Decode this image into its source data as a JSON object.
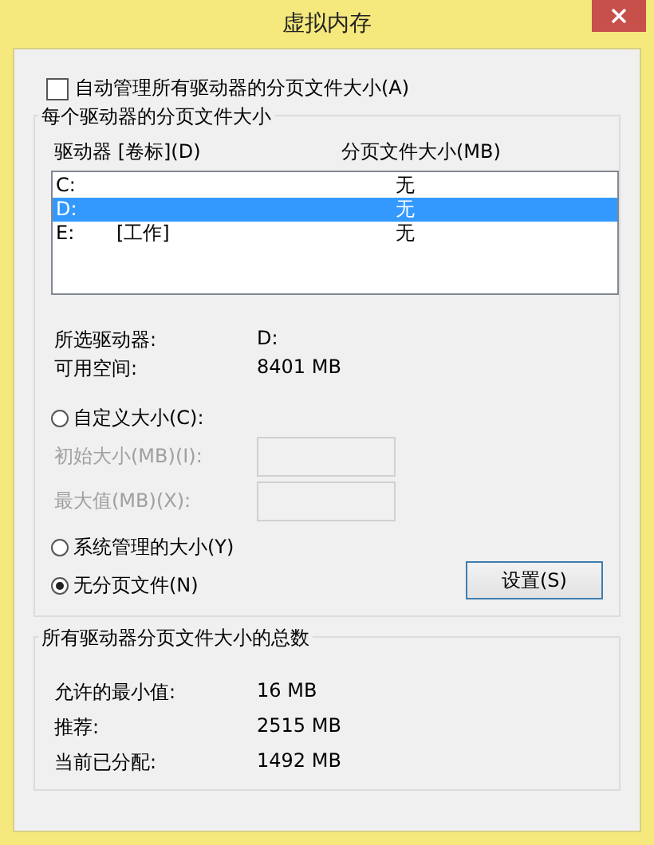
{
  "window": {
    "title": "虚拟内存"
  },
  "auto_manage": {
    "label": "自动管理所有驱动器的分页文件大小(A)",
    "checked": false
  },
  "per_drive": {
    "title": "每个驱动器的分页文件大小",
    "columns": [
      "驱动器 [卷标](D)",
      "分页文件大小(MB)"
    ],
    "drives": [
      {
        "drive": "C:",
        "size": "无",
        "selected": false
      },
      {
        "drive": "D:",
        "size": "无",
        "selected": true
      },
      {
        "drive": "E:",
        "label": "[工作]",
        "size": "无",
        "selected": false
      }
    ],
    "info": [
      {
        "label": "所选驱动器:",
        "value": "D:"
      },
      {
        "label": "可用空间:",
        "value": "8401 MB"
      }
    ],
    "custom_option": {
      "label": "自定义大小(C):",
      "selected": false
    },
    "custom_fields": [
      {
        "label": "初始大小(MB)(I):",
        "disabled": true
      },
      {
        "label": "最大值(MB)(X):",
        "disabled": true
      }
    ],
    "other_options": [
      {
        "label": "系统管理的大小(Y)",
        "selected": false
      },
      {
        "label": "无分页文件(N)",
        "selected": true
      }
    ],
    "set_button": "设置(S)"
  },
  "totals": {
    "title": "所有驱动器分页文件大小的总数",
    "rows": [
      {
        "label": "允许的最小值:",
        "value": "16 MB"
      },
      {
        "label": "推荐:",
        "value": "2515 MB"
      },
      {
        "label": "当前已分配:",
        "value": "1492 MB"
      }
    ]
  }
}
